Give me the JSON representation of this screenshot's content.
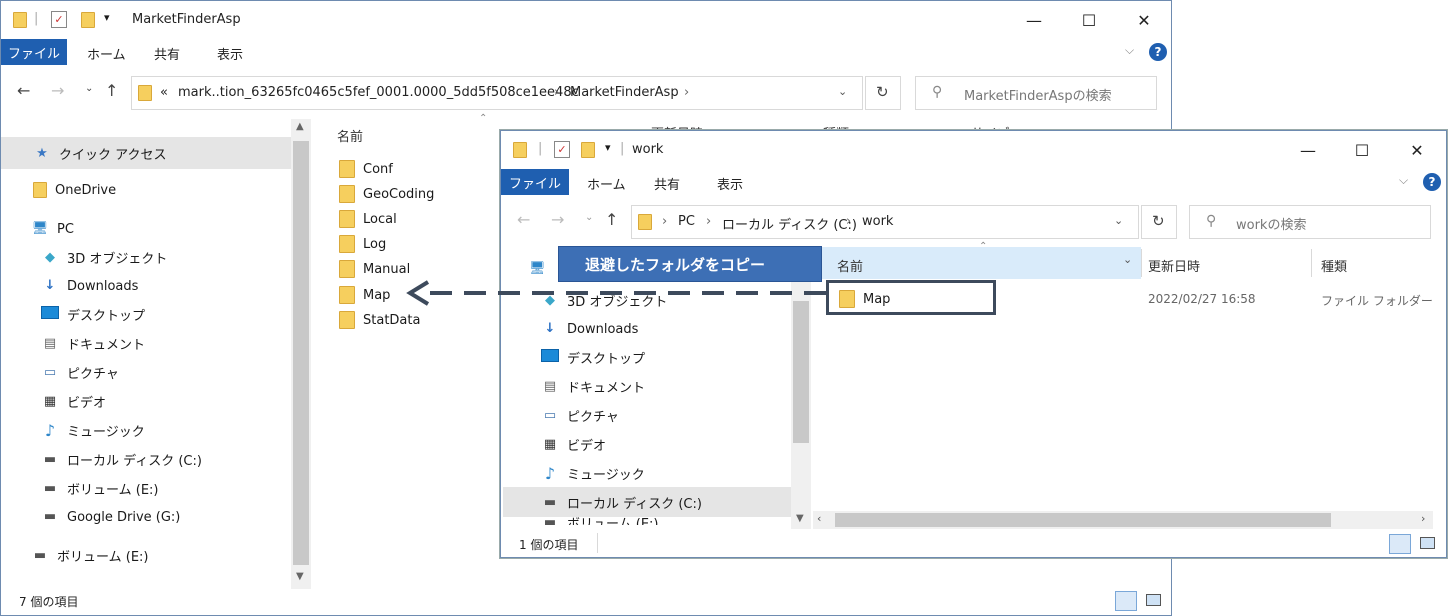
{
  "window1": {
    "title": "MarketFinderAsp",
    "ribbon_tabs": [
      "ファイル",
      "ホーム",
      "共有",
      "表示"
    ],
    "address": {
      "prefix": "«",
      "path1": "mark..tion_63265fc0465c5fef_0001.0000_5dd5f508ce1ee48c",
      "path2": "MarketFinderAsp"
    },
    "search_placeholder": "MarketFinderAspの検索",
    "nav_items": [
      {
        "label": "クイック アクセス",
        "icon": "star-icon"
      },
      {
        "label": "OneDrive",
        "icon": "folder-icon"
      },
      {
        "label": "PC",
        "icon": "pc-icon"
      },
      {
        "label": "3D オブジェクト",
        "icon": "3d-objects-icon"
      },
      {
        "label": "Downloads",
        "icon": "download-icon"
      },
      {
        "label": "デスクトップ",
        "icon": "desktop-icon"
      },
      {
        "label": "ドキュメント",
        "icon": "document-icon"
      },
      {
        "label": "ピクチャ",
        "icon": "picture-icon"
      },
      {
        "label": "ビデオ",
        "icon": "video-icon"
      },
      {
        "label": "ミュージック",
        "icon": "music-icon"
      },
      {
        "label": "ローカル ディスク (C:)",
        "icon": "local-disk-icon"
      },
      {
        "label": "ボリューム (E:)",
        "icon": "drive-icon"
      },
      {
        "label": "Google Drive (G:)",
        "icon": "drive-icon"
      },
      {
        "label": "ボリューム (E:)",
        "icon": "drive-icon"
      }
    ],
    "column_name": "名前",
    "partial_columns": [
      "更新日時",
      "種類",
      "サイズ"
    ],
    "files": [
      "Conf",
      "GeoCoding",
      "Local",
      "Log",
      "Manual",
      "Map",
      "StatData"
    ],
    "status": "7 個の項目"
  },
  "window2": {
    "title": "work",
    "ribbon_tabs": [
      "ファイル",
      "ホーム",
      "共有",
      "表示"
    ],
    "address": {
      "part1": "PC",
      "part2": "ローカル ディスク (C:)",
      "part3": "work"
    },
    "search_placeholder": "workの検索",
    "nav_items": [
      {
        "label": "3D オブジェクト",
        "icon": "3d-objects-icon"
      },
      {
        "label": "Downloads",
        "icon": "download-icon"
      },
      {
        "label": "デスクトップ",
        "icon": "desktop-icon"
      },
      {
        "label": "ドキュメント",
        "icon": "document-icon"
      },
      {
        "label": "ピクチャ",
        "icon": "picture-icon"
      },
      {
        "label": "ビデオ",
        "icon": "video-icon"
      },
      {
        "label": "ミュージック",
        "icon": "music-icon"
      },
      {
        "label": "ローカル ディスク (C:)",
        "icon": "local-disk-icon"
      },
      {
        "label": "ボリューム (E:)",
        "icon": "drive-icon"
      }
    ],
    "columns": {
      "name": "名前",
      "modified": "更新日時",
      "type": "種類"
    },
    "rows": [
      {
        "name": "Map",
        "modified": "2022/02/27 16:58",
        "type": "ファイル フォルダー"
      }
    ],
    "status": "1 個の項目"
  },
  "callout": {
    "text": "退避したフォルダをコピー"
  },
  "colors": {
    "accent": "#1f5fb0",
    "callout": "#3d6fb5",
    "arrow": "#3d4a5c",
    "folder": "#f6cf5e"
  }
}
